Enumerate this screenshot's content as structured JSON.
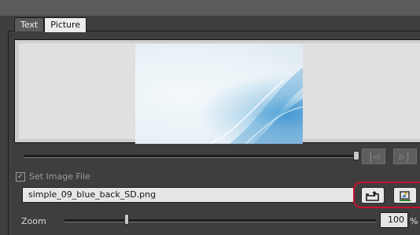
{
  "tabs": [
    {
      "label": "Text",
      "selected": false
    },
    {
      "label": "Picture",
      "selected": true
    }
  ],
  "preview": {
    "image_file": "simple_09_blue_back_SD.png"
  },
  "navigation": {
    "first_icon": "skip-to-start-icon",
    "last_icon": "skip-to-end-icon"
  },
  "set_image_file": {
    "label": "Set Image File",
    "checked": true,
    "enabled": false
  },
  "file": {
    "name": "simple_09_blue_back_SD.png",
    "open_icon": "folder-open-icon",
    "paint_icon": "paint-image-icon"
  },
  "zoom": {
    "label": "Zoom",
    "value": "100",
    "unit": "%"
  },
  "colors": {
    "highlight": "#c8102e",
    "panel_bg": "#3e3e3e"
  }
}
